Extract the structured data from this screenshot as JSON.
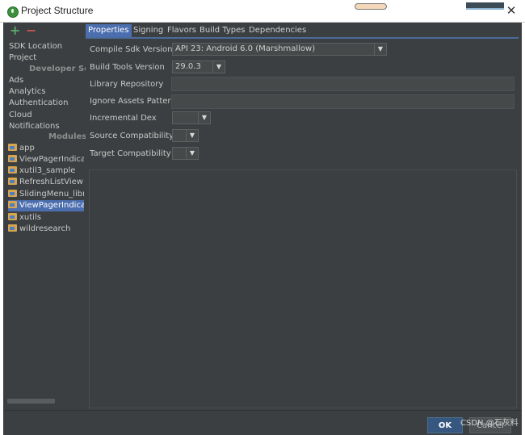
{
  "window": {
    "title": "Project Structure",
    "close_glyph": "✕"
  },
  "toolbar": {
    "add_glyph": "+",
    "remove_glyph": "−"
  },
  "nav": {
    "top_items": [
      "SDK Location",
      "Project"
    ],
    "developer_header": "Developer Ser",
    "developer_items": [
      "Ads",
      "Analytics",
      "Authentication",
      "Cloud",
      "Notifications"
    ],
    "modules_header": "Modules",
    "modules": [
      {
        "label": "app",
        "selected": false
      },
      {
        "label": "ViewPagerIndica",
        "selected": false
      },
      {
        "label": "xutil3_sample",
        "selected": false
      },
      {
        "label": "RefreshListView",
        "selected": false
      },
      {
        "label": "SlidingMenu_libr",
        "selected": false
      },
      {
        "label": "ViewPagerIndica",
        "selected": true
      },
      {
        "label": "xutils",
        "selected": false
      },
      {
        "label": "wildresearch",
        "selected": false
      }
    ]
  },
  "tabs": [
    {
      "label": "Properties",
      "active": true
    },
    {
      "label": "Signing",
      "active": false
    },
    {
      "label": "Flavors",
      "active": false
    },
    {
      "label": "Build Types",
      "active": false
    },
    {
      "label": "Dependencies",
      "active": false
    }
  ],
  "properties": {
    "compile_sdk_label": "Compile Sdk Version",
    "compile_sdk_value": "API 23: Android 6.0 (Marshmallow)",
    "build_tools_label": "Build Tools Version",
    "build_tools_value": "29.0.3",
    "library_repo_label": "Library Repository",
    "library_repo_value": "",
    "ignore_assets_label": "Ignore Assets Pattern",
    "ignore_assets_value": "",
    "incremental_dex_label": "Incremental Dex",
    "incremental_dex_value": "",
    "source_compat_label": "Source Compatibility",
    "source_compat_value": "",
    "target_compat_label": "Target Compatibility",
    "target_compat_value": ""
  },
  "buttons": {
    "ok": "OK",
    "cancel": "Cancel"
  },
  "watermark": "CSDN @石灰料",
  "icons": {
    "app": "android-studio-icon",
    "module": "module-folder-icon",
    "dropdown": "chevron-down-icon"
  },
  "colors": {
    "background": "#3c3f41",
    "selection": "#4b6eaf",
    "add": "#59a869",
    "remove": "#c75450",
    "ok_button": "#365880"
  }
}
